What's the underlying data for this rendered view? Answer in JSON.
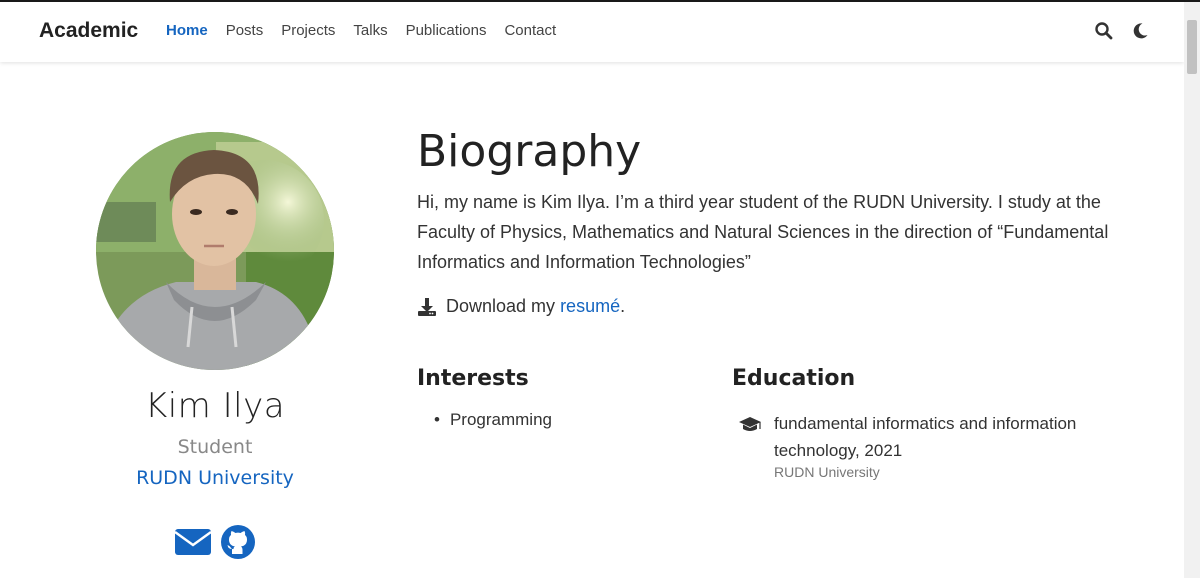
{
  "navbar": {
    "brand": "Academic",
    "links": [
      "Home",
      "Posts",
      "Projects",
      "Talks",
      "Publications",
      "Contact"
    ],
    "active": "Home",
    "icons": [
      "search-icon",
      "moon-icon"
    ]
  },
  "profile": {
    "avatar": "profile-photo",
    "name": "Kim Ilya",
    "role": "Student",
    "organization": "RUDN University",
    "social_icons": [
      "envelope-icon",
      "github-icon"
    ]
  },
  "biography": {
    "heading": "Biography",
    "text": "Hi, my name is Kim Ilya. I’m a third year student of the RUDN University. I study at the Faculty of Physics, Mathematics and Natural Sciences in the direction of “Fundamental Informatics and Information Technologies”",
    "download_prefix": "Download my ",
    "download_link": "resumé",
    "download_suffix": "."
  },
  "interests": {
    "heading": "Interests",
    "items": [
      "Programming"
    ]
  },
  "education": {
    "heading": "Education",
    "items": [
      {
        "course": "fundamental informatics and information technology, 2021",
        "institution": "RUDN University",
        "icon": "graduation-cap-icon"
      }
    ]
  },
  "colors": {
    "accent": "#1565c0",
    "text": "#333333",
    "muted": "#888888"
  }
}
